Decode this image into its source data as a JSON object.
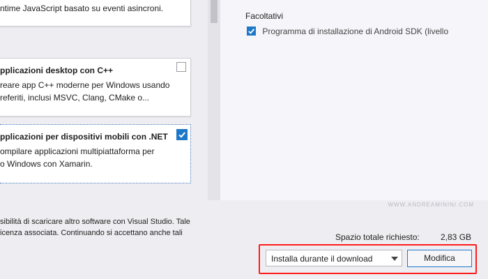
{
  "workloads": [
    {
      "title": "",
      "desc": [
        "ntime JavaScript basato su eventi asincroni."
      ],
      "checked": false
    },
    {
      "title": "pplicazioni desktop con C++",
      "desc": [
        "reare app C++ moderne per Windows usando",
        "referiti, inclusi MSVC, Clang, CMake o..."
      ],
      "checked": false
    },
    {
      "title": "pplicazioni per dispositivi mobili con .NET",
      "desc": [
        "ompilare applicazioni multipiattaforma per",
        "o Windows con Xamarin."
      ],
      "checked": true
    }
  ],
  "details": {
    "section_title": "Facoltativi",
    "optional_item": "Programma di installazione di Android SDK (livello"
  },
  "watermark": "WWW.ANDREAMININI.COM",
  "footer": {
    "lines": [
      "sibilità di scaricare altro software con Visual Studio. Tale",
      "icenza associata. Continuando si accettano anche tali"
    ],
    "space_label": "Spazio totale richiesto:",
    "space_value": "2,83 GB",
    "install_mode": "Installa durante il download",
    "modify_label": "Modifica"
  },
  "colors": {
    "accent": "#1e78c8",
    "highlight": "#ff1a1a"
  },
  "icons": {
    "check": "check-icon",
    "dropdown": "chevron-down-icon"
  }
}
